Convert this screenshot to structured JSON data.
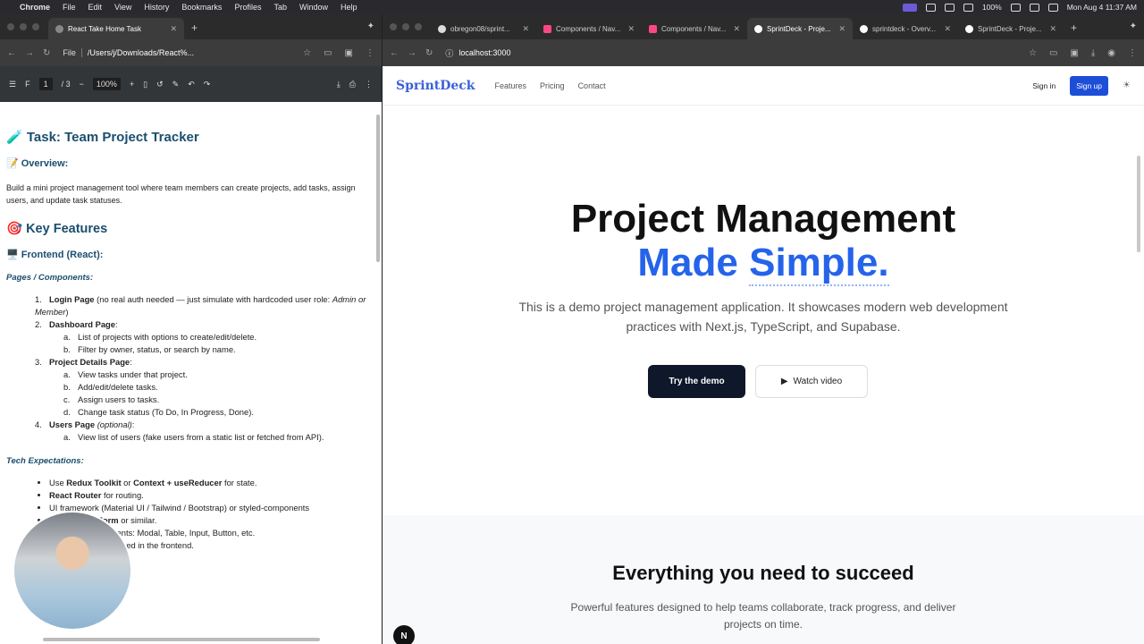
{
  "menubar": {
    "app": "Chrome",
    "items": [
      "File",
      "Edit",
      "View",
      "History",
      "Bookmarks",
      "Profiles",
      "Tab",
      "Window",
      "Help"
    ],
    "battery": "100%",
    "clock": "Mon Aug 4  11:37 AM"
  },
  "left_window": {
    "tab_title": "React Take Home Task",
    "address_chip": "File",
    "address": "/Users/j/Downloads/React%...",
    "pdf": {
      "page_current": "1",
      "page_total": "/ 3",
      "zoom": "100%"
    },
    "doc": {
      "title": "🧪 Task: Team Project Tracker",
      "overview_heading": "📝 Overview:",
      "overview_text": "Build a mini project management tool where team members can create projects, add tasks, assign users, and update task statuses.",
      "key_features": "🎯 Key Features",
      "frontend_heading": "🖥️ Frontend (React):",
      "pages_heading": "Pages / Components:",
      "pages": [
        {
          "n": "1.",
          "title": "Login Page",
          "rest": " (no real auth needed — just simulate with hardcoded user role: ",
          "em": "Admin or Member",
          "close": ")",
          "sub": []
        },
        {
          "n": "2.",
          "title": "Dashboard Page",
          "rest": ":",
          "em": "",
          "close": "",
          "sub": [
            "List of projects with options to create/edit/delete.",
            "Filter by owner, status, or search by name."
          ]
        },
        {
          "n": "3.",
          "title": "Project Details Page",
          "rest": ":",
          "em": "",
          "close": "",
          "sub": [
            "View tasks under that project.",
            "Add/edit/delete tasks.",
            "Assign users to tasks.",
            "Change task status (To Do, In Progress, Done)."
          ]
        },
        {
          "n": "4.",
          "title": "Users Page",
          "rest": " ",
          "em": "(optional)",
          "close": ":",
          "sub": [
            "View list of users (fake users from a static list or fetched from API)."
          ]
        }
      ],
      "sub_letters": [
        "a.",
        "b.",
        "c.",
        "d."
      ],
      "tech_heading": "Tech Expectations:",
      "tech": [
        {
          "pre": "Use ",
          "b1": "Redux Toolkit",
          "mid": " or ",
          "b2": "Context + useReducer",
          "post": " for state."
        },
        {
          "pre": "",
          "b1": "React Router",
          "mid": " for routing.",
          "b2": "",
          "post": ""
        },
        {
          "pre": "",
          "b1": "",
          "mid": "UI framework (Material UI / Tailwind / Bootstrap) or styled-components",
          "b2": "",
          "post": ""
        },
        {
          "pre": "",
          "b1": "React Hook Form",
          "mid": " or similar.",
          "b2": "",
          "post": ""
        },
        {
          "pre": "",
          "b1": "",
          "mid": "Reusable components: Modal, Table, Input, Button, etc.",
          "b2": "",
          "post": ""
        },
        {
          "pre": "",
          "b1": "",
          "mid": "Validation implemented in the frontend.",
          "b2": "",
          "post": ""
        }
      ]
    }
  },
  "right_window": {
    "tabs": [
      {
        "title": "obregon08/sprint...",
        "icon": "github-icon",
        "active": false
      },
      {
        "title": "Components / Nav...",
        "icon": "storybook-icon",
        "active": false
      },
      {
        "title": "Components / Nav...",
        "icon": "storybook-icon",
        "active": false
      },
      {
        "title": "SprintDeck - Proje...",
        "icon": "vercel-icon",
        "active": true
      },
      {
        "title": "sprintdeck - Overv...",
        "icon": "vercel-icon",
        "active": false
      },
      {
        "title": "SprintDeck - Proje...",
        "icon": "vercel-icon",
        "active": false
      }
    ],
    "address": "localhost:3000",
    "site": {
      "logo": "SprintDeck",
      "nav": [
        "Features",
        "Pricing",
        "Contact"
      ],
      "sign_in": "Sign in",
      "sign_up": "Sign up",
      "hero_line1": "Project Management",
      "hero_line2a": "Made ",
      "hero_line2b": "Simple.",
      "hero_desc": "This is a demo project management application. It showcases modern web development practices with Next.js, TypeScript, and Supabase.",
      "cta_primary": "Try the demo",
      "cta_secondary": "Watch video",
      "features_title": "Everything you need to succeed",
      "features_desc": "Powerful features designed to help teams collaborate, track progress, and deliver projects on time.",
      "badge": "N"
    }
  },
  "colors": {
    "brand_blue": "#2563eb",
    "dark_button": "#0f172a",
    "doc_heading": "#1a4e6e"
  }
}
